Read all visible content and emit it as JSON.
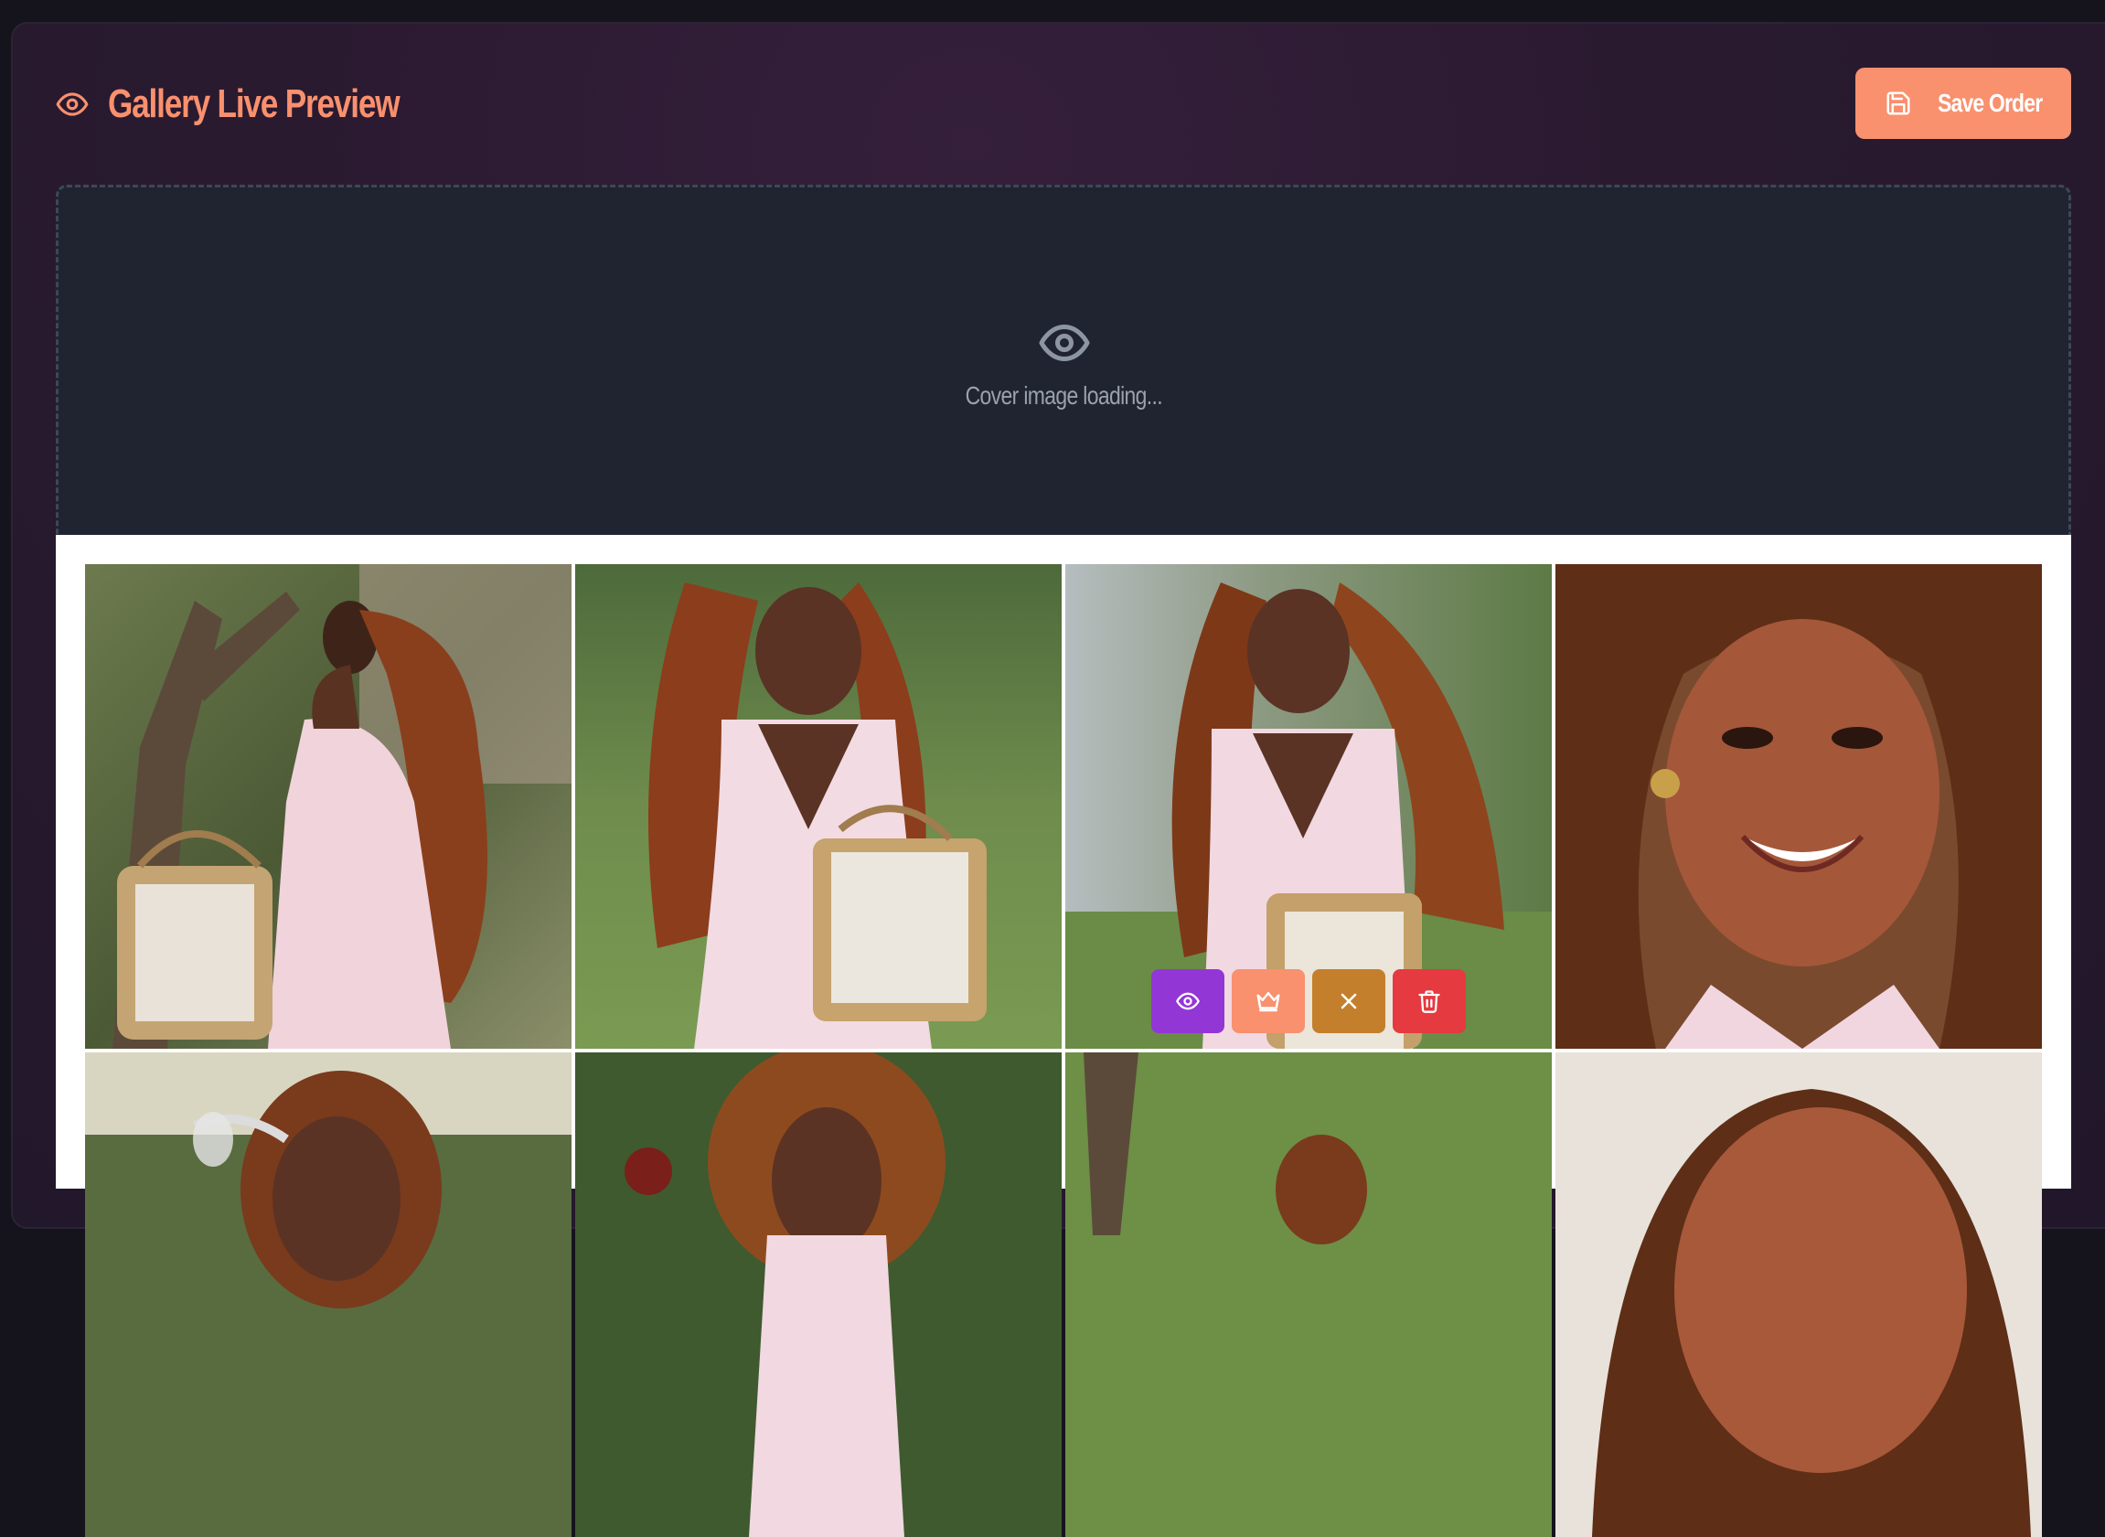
{
  "header": {
    "title": "Gallery Live Preview",
    "icon": "eye-icon",
    "save_label": "Save Order",
    "save_icon": "save-icon"
  },
  "cover": {
    "status_text": "Cover image loading...",
    "icon": "eye-icon"
  },
  "colors": {
    "accent": "#f9906e",
    "view": "#9336d6",
    "set_cover": "#f9906e",
    "remove": "#c47f2c",
    "delete": "#e43a40",
    "cover_bg": "#1f2430"
  },
  "gallery": {
    "photos": [
      {
        "icon": "photo-image"
      },
      {
        "icon": "photo-image"
      },
      {
        "icon": "photo-image",
        "hovered": true
      },
      {
        "icon": "photo-image"
      },
      {
        "icon": "photo-image"
      },
      {
        "icon": "photo-image"
      },
      {
        "icon": "photo-image"
      },
      {
        "icon": "photo-image"
      }
    ],
    "hover_actions": [
      {
        "name": "view",
        "icon": "eye-icon"
      },
      {
        "name": "set-cover",
        "icon": "crown-icon"
      },
      {
        "name": "remove",
        "icon": "close-icon"
      },
      {
        "name": "delete",
        "icon": "trash-icon"
      }
    ]
  }
}
